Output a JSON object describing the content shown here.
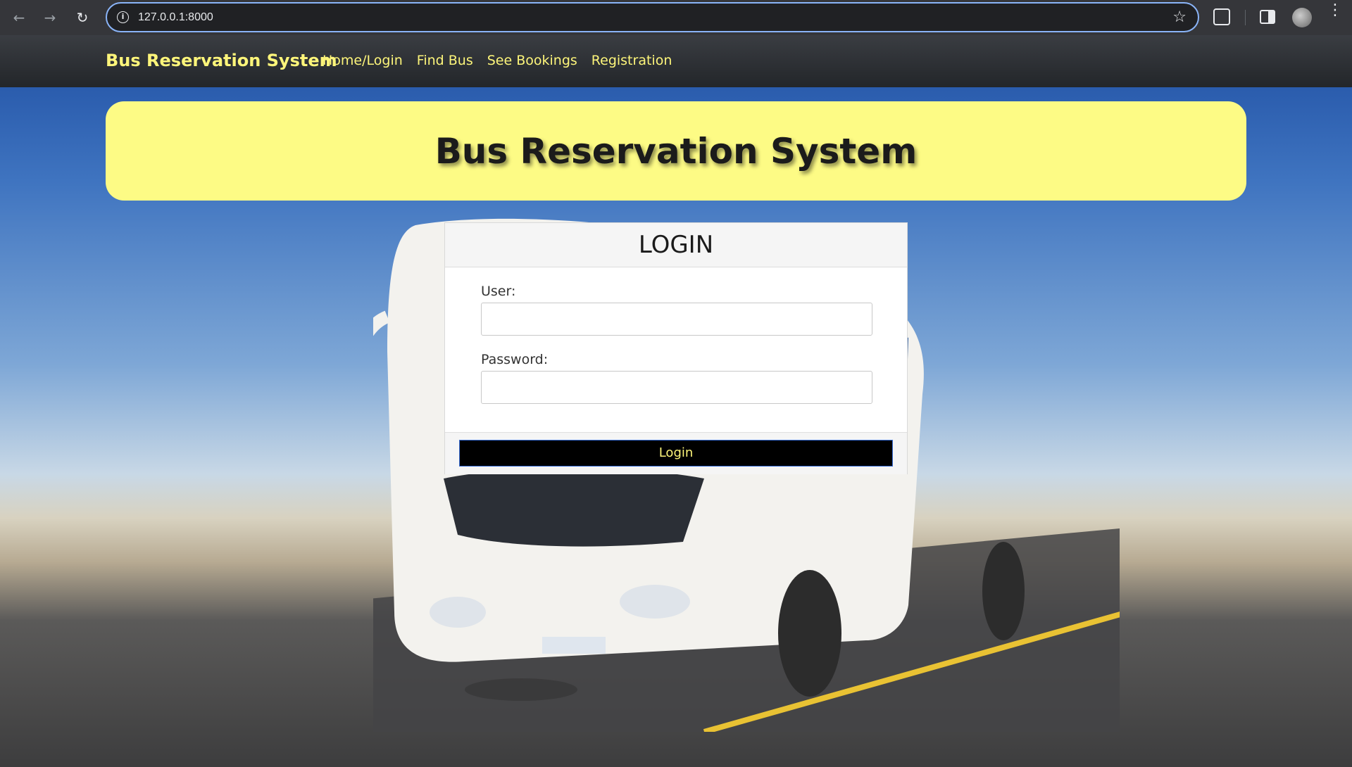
{
  "browser": {
    "url": "127.0.0.1:8000"
  },
  "navbar": {
    "brand": "Bus Reservation System",
    "links": [
      "Home/Login",
      "Find Bus",
      "See Bookings",
      "Registration"
    ]
  },
  "hero": {
    "title": "Bus Reservation System"
  },
  "login": {
    "title": "LOGIN",
    "user_label": "User:",
    "user_value": "",
    "password_label": "Password:",
    "password_value": "",
    "button_label": "Login"
  },
  "colors": {
    "accent_yellow": "#fdf57a",
    "hero_background": "#fdfb85",
    "navbar_background": "#2b2e33",
    "button_background": "#000000"
  },
  "icons": [
    "back-arrow-icon",
    "forward-arrow-icon",
    "reload-icon",
    "site-info-icon",
    "bookmark-star-icon",
    "extensions-icon",
    "side-panel-icon",
    "profile-avatar-icon",
    "more-menu-icon"
  ]
}
